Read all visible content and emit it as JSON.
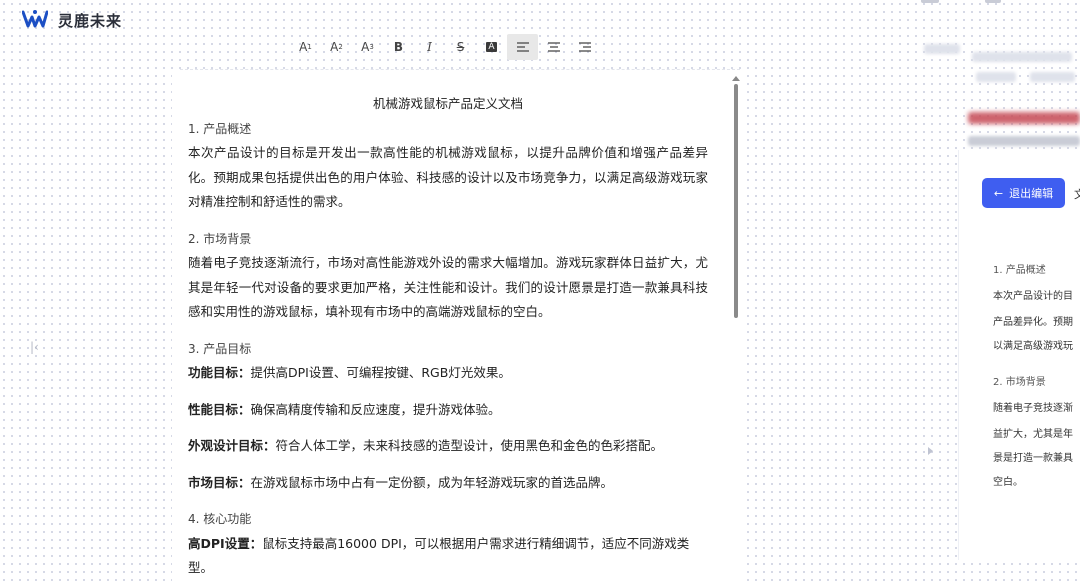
{
  "app": {
    "brand_name": "灵鹿未来",
    "brand_color": "#1c4fc4",
    "logo_icon": "deer-logo-icon"
  },
  "toolbar": {
    "tools": [
      {
        "name": "heading-1",
        "label": "A",
        "sub": "1"
      },
      {
        "name": "heading-2",
        "label": "A",
        "sub": "2"
      },
      {
        "name": "heading-3",
        "label": "A",
        "sub": "3"
      },
      {
        "name": "bold",
        "label": "B"
      },
      {
        "name": "italic",
        "label": "I"
      },
      {
        "name": "strikethrough",
        "label": "S"
      },
      {
        "name": "highlight",
        "label": "A"
      },
      {
        "name": "align-left",
        "icon": "align-left-icon"
      },
      {
        "name": "align-center",
        "icon": "align-center-icon"
      },
      {
        "name": "align-right",
        "icon": "align-right-icon"
      }
    ],
    "active_tool": "align-left"
  },
  "document": {
    "title": "机械游戏鼠标产品定义文档",
    "s1_head": "1. 产品概述",
    "s1_text": "本次产品设计的目标是开发出一款高性能的机械游戏鼠标，以提升品牌价值和增强产品差异化。预期成果包括提供出色的用户体验、科技感的设计以及市场竞争力，以满足高级游戏玩家对精准控制和舒适性的需求。",
    "s2_head": "2. 市场背景",
    "s2_text": "随着电子竞技逐渐流行，市场对高性能游戏外设的需求大幅增加。游戏玩家群体日益扩大，尤其是年轻一代对设备的要求更加严格，关注性能和设计。我们的设计愿景是打造一款兼具科技感和实用性的游戏鼠标，填补现有市场中的高端游戏鼠标的空白。",
    "s3_head": "3. 产品目标",
    "goals": [
      {
        "label": "功能目标：",
        "text": "提供高DPI设置、可编程按键、RGB灯光效果。"
      },
      {
        "label": "性能目标：",
        "text": "确保高精度传输和反应速度，提升游戏体验。"
      },
      {
        "label": "外观设计目标：",
        "text": "符合人体工学，未来科技感的造型设计，使用黑色和金色的色彩搭配。"
      },
      {
        "label": "市场目标：",
        "text": "在游戏鼠标市场中占有一定份额，成为年轻游戏玩家的首选品牌。"
      }
    ],
    "s4_head": "4. 核心功能",
    "f1_label": "高DPI设置：",
    "f1_text": "鼠标支持最高16000 DPI，可以根据用户需求进行精细调节，适应不同游戏类型。"
  },
  "right_panel": {
    "exit_label": "退出编辑",
    "exit_icon": "arrow-left-icon",
    "exit_color": "#3f5ef0",
    "more_label": "文",
    "lines": [
      {
        "text": "1. 产品概述",
        "head": true
      },
      {
        "text": "本次产品设计的目"
      },
      {
        "text": "产品差异化。预期"
      },
      {
        "text": "以满足高级游戏玩"
      },
      {
        "text": "2. 市场背景",
        "head": true
      },
      {
        "text": "随着电子竞技逐渐"
      },
      {
        "text": "益扩大，尤其是年"
      },
      {
        "text": "景是打造一款兼具"
      },
      {
        "text": "空白。"
      }
    ]
  }
}
